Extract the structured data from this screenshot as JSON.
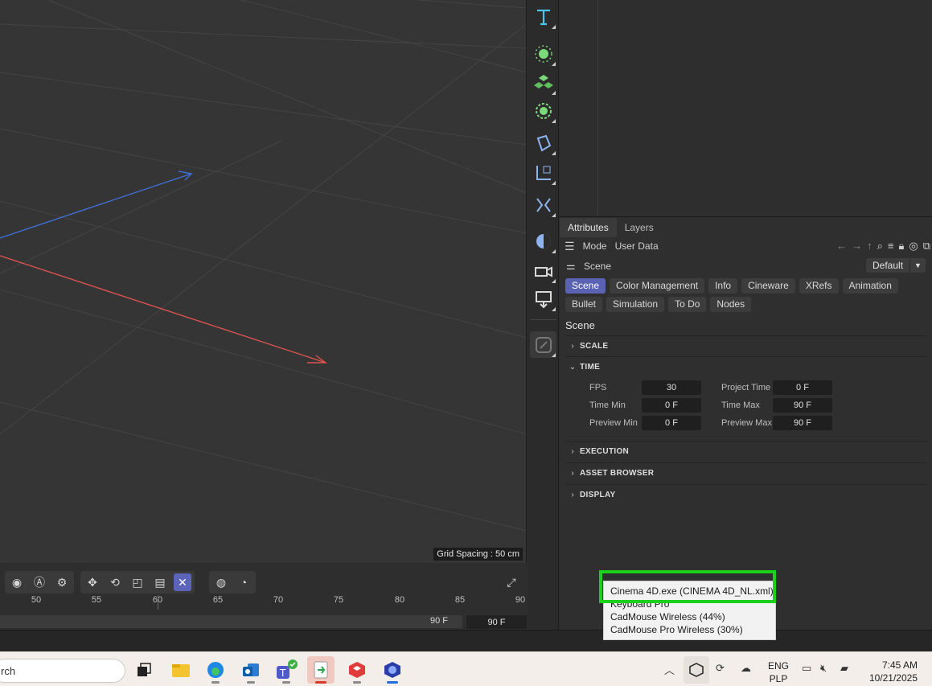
{
  "viewport": {
    "grid_spacing_label": "Grid Spacing : 50 cm"
  },
  "timeline": {
    "ticks": [
      "50",
      "55",
      "60",
      "65",
      "70",
      "75",
      "80",
      "85",
      "90"
    ],
    "end_label": "90 F",
    "end_field": "90 F"
  },
  "attributes": {
    "panel_tabs": [
      "Attributes",
      "Layers"
    ],
    "menu": [
      "Mode",
      "User Data"
    ],
    "object_label": "Scene",
    "preset": "Default",
    "tabs": [
      "Scene",
      "Color Management",
      "Info",
      "Cineware",
      "XRefs",
      "Animation",
      "Bullet",
      "Simulation",
      "To Do",
      "Nodes"
    ],
    "section_title": "Scene",
    "sections": {
      "scale": "SCALE",
      "time": "TIME",
      "execution": "EXECUTION",
      "asset_browser": "ASSET BROWSER",
      "display": "DISPLAY"
    },
    "fields": {
      "fps_label": "FPS",
      "fps": "30",
      "project_time_label": "Project Time",
      "project_time": "0 F",
      "time_min_label": "Time Min",
      "time_min": "0 F",
      "time_max_label": "Time Max",
      "time_max": "90 F",
      "preview_min_label": "Preview Min",
      "preview_min": "0 F",
      "preview_max_label": "Preview Max",
      "preview_max": "90 F"
    }
  },
  "tray_popup": {
    "items": [
      "Cinema 4D.exe (CINEMA 4D_NL.xml)",
      "Keyboard Pro",
      "CadMouse Wireless (44%)",
      "CadMouse Pro Wireless (30%)"
    ]
  },
  "taskbar": {
    "search_text": "rch",
    "lang_top": "ENG",
    "lang_bottom": "PLP",
    "time": "7:45 AM",
    "date": "10/21/2025"
  },
  "colors": {
    "accent": "#5a62b3",
    "highlight": "#1bd11b",
    "axis_x": "#d9534f",
    "axis_z": "#3f6fd8"
  }
}
